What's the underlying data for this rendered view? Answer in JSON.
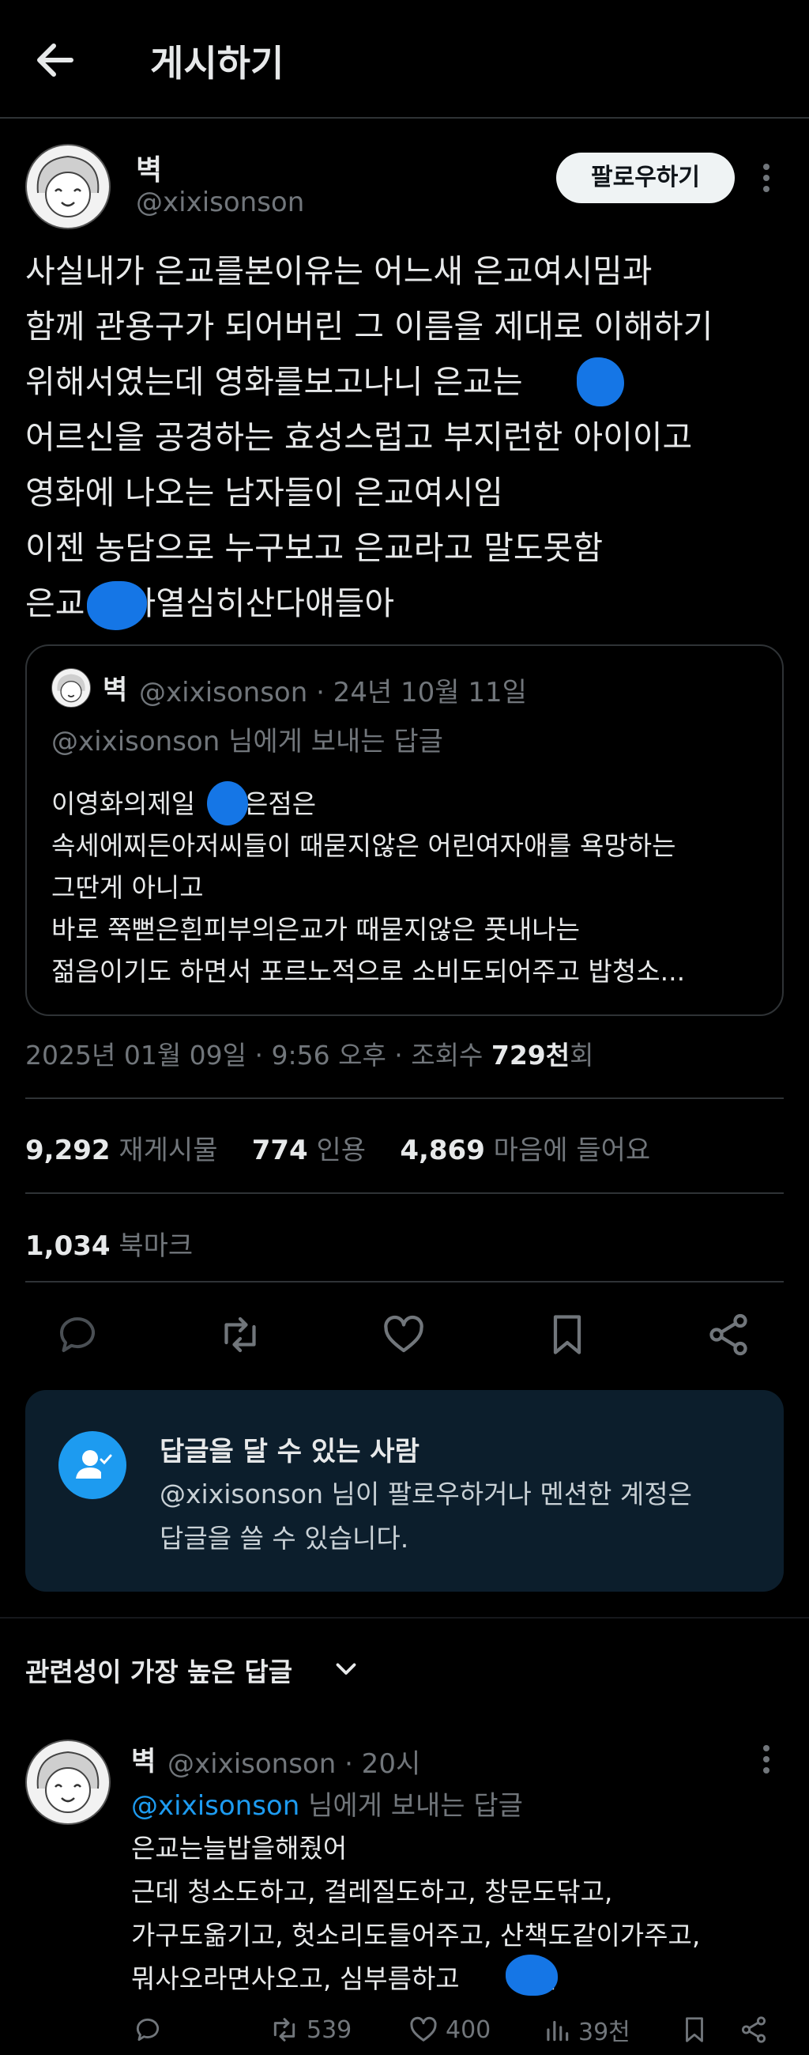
{
  "header": {
    "title": "게시하기"
  },
  "author": {
    "name": "벽",
    "handle": "@xixisonson",
    "follow_label": "팔로우하기"
  },
  "post": {
    "body": "사실내가 은교를본이유는 어느새 은교여시밈과\n함께 관용구가 되어버린 그 이름을 제대로 이해하기\n위해서였는데 영화를보고나니 은교는      할\n어르신을 공경하는 효성스럽고 부지런한 아이이고\n영화에 나오는 남자들이 은교여시임\n이젠 농담으로 누구보고 은교라고 말도못함\n은교    나열심히산다얘들아"
  },
  "quote": {
    "name": "벽",
    "meta": "@xixisonson · 24년 10월 11일",
    "reply_to": "@xixisonson 님에게 보내는 답글",
    "body": "이영화의제일   같은점은\n속세에찌든아저씨들이 때묻지않은 어린여자애를 욕망하는\n그딴게 아니고\n바로 쭉뻗은흰피부의은교가 때묻지않은 풋내나는\n젊음이기도 하면서 포르노적으로 소비도되어주고 밥청소..."
  },
  "timestamp": {
    "date": "2025년 01월 09일 · 9:56 오후 · 조회수 ",
    "views": "729천",
    "views_unit": "회"
  },
  "stats": {
    "reposts": "9,292",
    "reposts_label": "재게시물",
    "quotes": "774",
    "quotes_label": "인용",
    "likes": "4,869",
    "likes_label": "마음에 들어요",
    "bookmarks": "1,034",
    "bookmarks_label": "북마크"
  },
  "reply_restriction": {
    "title": "답글을 달 수 있는 사람",
    "description": "@xixisonson 님이 팔로우하거나 멘션한 계정은\n답글을 쓸 수 있습니다."
  },
  "replies_sort": {
    "label": "관련성이 가장 높은 답글"
  },
  "reply": {
    "name": "벽",
    "meta": "@xixisonson · 20시",
    "reply_to_handle": "@xixisonson",
    "reply_to_suffix": " 님에게 보내는 답글",
    "body": "은교는늘밥을해줬어\n근데 청소도하고, 걸레질도하고, 창문도닦고,\n가구도옮기고, 헛소리도들어주고, 산책도같이가주고,\n뭐사오라면사오고, 심부름하고      그만",
    "reposts": "539",
    "likes": "400",
    "views": "39천"
  },
  "colors": {
    "accent": "#1d9bf0",
    "background": "#000000",
    "card": "#0c1e2c",
    "border": "#2f3336",
    "muted": "#71767b"
  },
  "icons": [
    "back-arrow-icon",
    "more-icon",
    "reply-icon",
    "repost-icon",
    "like-icon",
    "bookmark-icon",
    "share-icon",
    "user-check-icon",
    "chevron-down-icon",
    "views-icon"
  ]
}
